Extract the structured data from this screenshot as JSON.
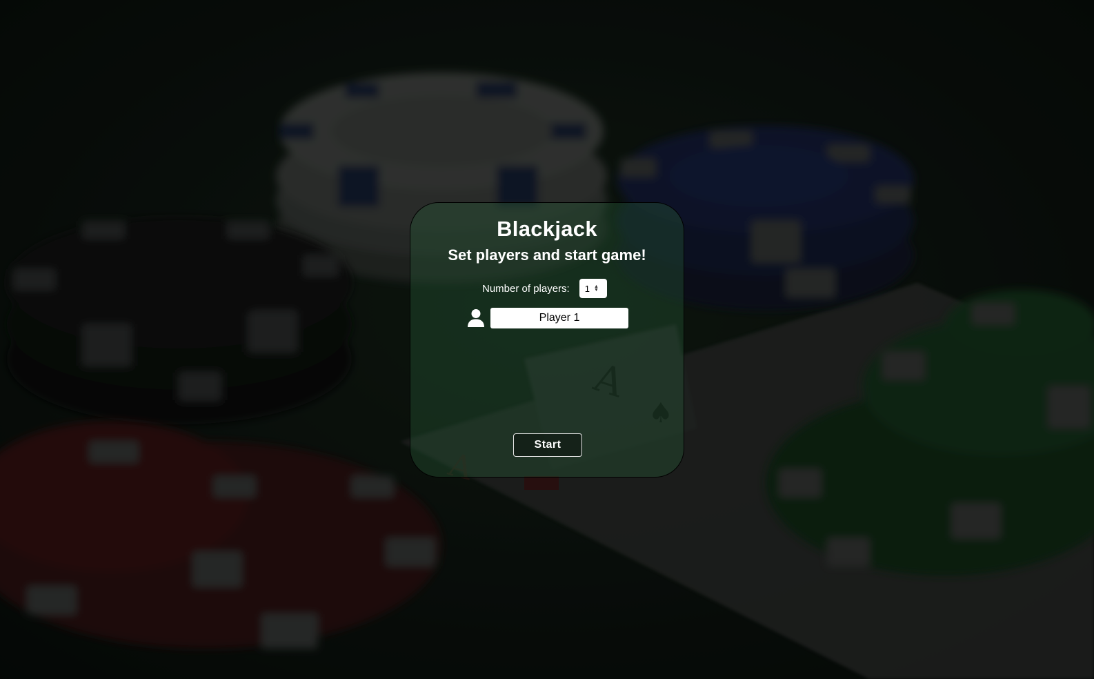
{
  "app": {
    "title": "Blackjack",
    "subtitle": "Set players and start game!"
  },
  "players": {
    "count_label": "Number of players:",
    "count_value": "1",
    "list": [
      {
        "name": "Player 1",
        "icon": "user-icon"
      }
    ]
  },
  "actions": {
    "start_label": "Start"
  },
  "background": {
    "description_icon": "casino-chips-and-cards-background"
  }
}
